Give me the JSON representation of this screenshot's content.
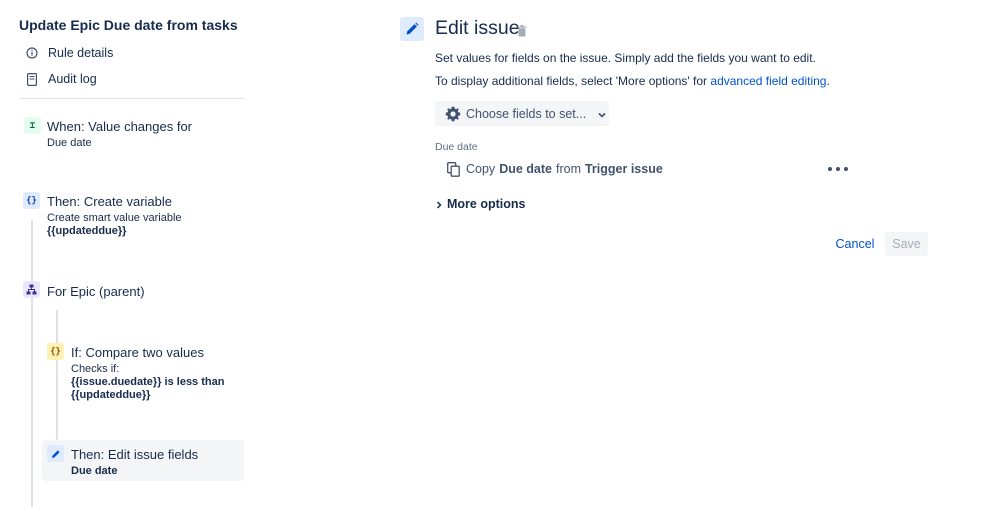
{
  "sidebar": {
    "rule_title": "Update Epic Due date from tasks",
    "nav": [
      {
        "label": "Rule details",
        "icon": "info-icon"
      },
      {
        "label": "Audit log",
        "icon": "document-icon"
      }
    ],
    "steps": [
      {
        "title": "When: Value changes for",
        "lines": [
          "Due date"
        ],
        "icon": "trigger-icon",
        "glyph": "⌶"
      },
      {
        "title": "Then: Create variable",
        "lines": [
          "Create smart value variable",
          "{{updateddue}}"
        ],
        "icon": "braces-icon",
        "glyph": "{}"
      },
      {
        "title": "For Epic (parent)",
        "lines": [],
        "icon": "hierarchy-icon"
      },
      {
        "title": "If: Compare two values",
        "lines": [
          "Checks if:",
          "{{issue.duedate}} is less than",
          "{{updateddue}}"
        ],
        "icon": "braces-icon",
        "glyph": "{}"
      },
      {
        "title": "Then: Edit issue fields",
        "lines": [
          "Due date"
        ],
        "icon": "pencil-icon"
      }
    ]
  },
  "main": {
    "title": "Edit issue",
    "desc_1": "Set values for fields on the issue. Simply add the fields you want to edit.",
    "desc_2_prefix": "To display additional fields, select 'More options' for ",
    "desc_2_link": "advanced field editing",
    "desc_2_suffix": ".",
    "choose_label": "Choose fields to set...",
    "field_label": "Due date",
    "copy": {
      "word_copy": "Copy",
      "field": "Due date",
      "word_from": "from",
      "source": "Trigger issue"
    },
    "more_options_label": "More options",
    "cancel_label": "Cancel",
    "save_label": "Save"
  },
  "colors": {
    "text": "#172B4D",
    "link": "#0052CC",
    "subtle": "#42526E",
    "muted": "#5E6C84",
    "neutral_bg": "#F4F5F7",
    "border": "#DFE1E6",
    "disabled_text": "#A5ADBA"
  }
}
